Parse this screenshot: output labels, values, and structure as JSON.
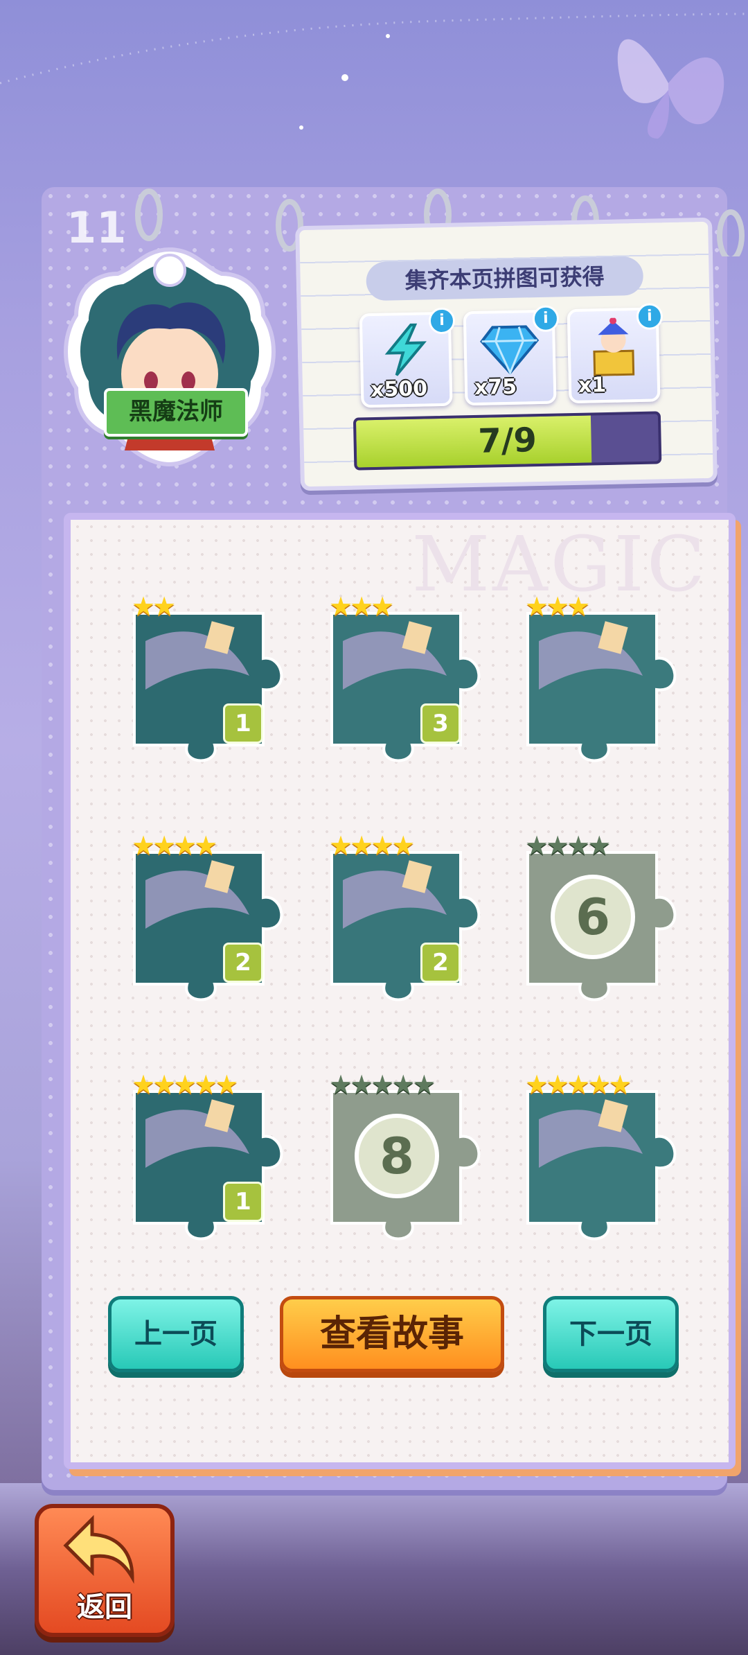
{
  "page_number": "11",
  "character": {
    "name": "黑魔法师"
  },
  "reward": {
    "title": "集齐本页拼图可获得",
    "items": [
      {
        "icon": "lightning-icon",
        "qty": "x500"
      },
      {
        "icon": "diamond-icon",
        "qty": "x75"
      },
      {
        "icon": "jester-box-icon",
        "qty": "x1"
      }
    ],
    "progress_text": "7/9",
    "progress_fraction": 0.7778
  },
  "watermark": "MAGIC",
  "pieces": [
    {
      "stars": 2,
      "total_stars": 2,
      "count": "1",
      "unlocked": true
    },
    {
      "stars": 3,
      "total_stars": 3,
      "count": "3",
      "unlocked": true
    },
    {
      "stars": 3,
      "total_stars": 3,
      "count": "",
      "unlocked": true
    },
    {
      "stars": 4,
      "total_stars": 4,
      "count": "2",
      "unlocked": true
    },
    {
      "stars": 4,
      "total_stars": 4,
      "count": "2",
      "unlocked": true
    },
    {
      "stars": 0,
      "total_stars": 4,
      "number": "6",
      "unlocked": false
    },
    {
      "stars": 5,
      "total_stars": 5,
      "count": "1",
      "unlocked": true
    },
    {
      "stars": 0,
      "total_stars": 5,
      "number": "8",
      "unlocked": false
    },
    {
      "stars": 5,
      "total_stars": 5,
      "count": "",
      "unlocked": true
    }
  ],
  "buttons": {
    "prev": "上一页",
    "story": "查看故事",
    "next": "下一页",
    "back": "返回"
  },
  "colors": {
    "accent_teal": "#28c9b7",
    "accent_orange": "#ff8f1f",
    "progress_green": "#a8d12d",
    "locked_grey": "#8f9c8d"
  }
}
